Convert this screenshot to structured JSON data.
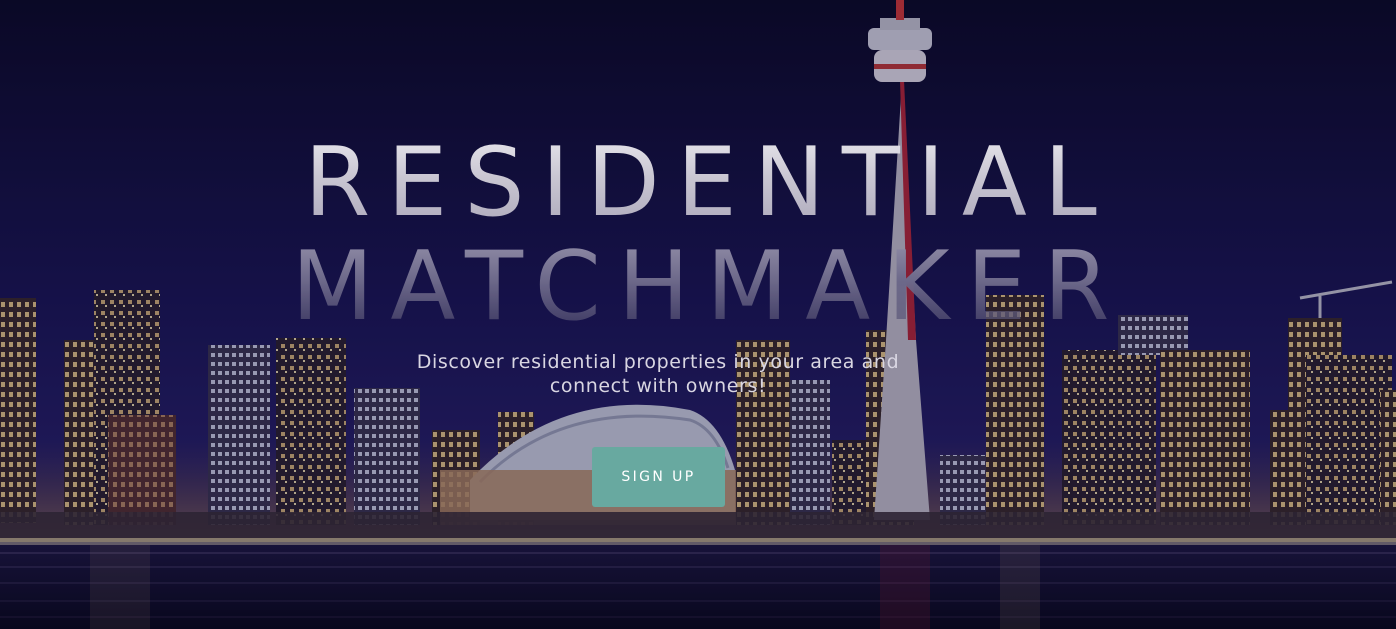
{
  "hero": {
    "title_line_1": "RESIDENTIAL",
    "title_line_2": "MATCHMAKER",
    "tagline": "Discover residential properties in your area and connect with owners!",
    "cta_label": "SIGN UP"
  },
  "colors": {
    "sky": "#0c0a2a",
    "water": "#0a0a22",
    "button": "#68a9a0",
    "title": "#d3d0da",
    "tagline": "#d9d6e2"
  }
}
